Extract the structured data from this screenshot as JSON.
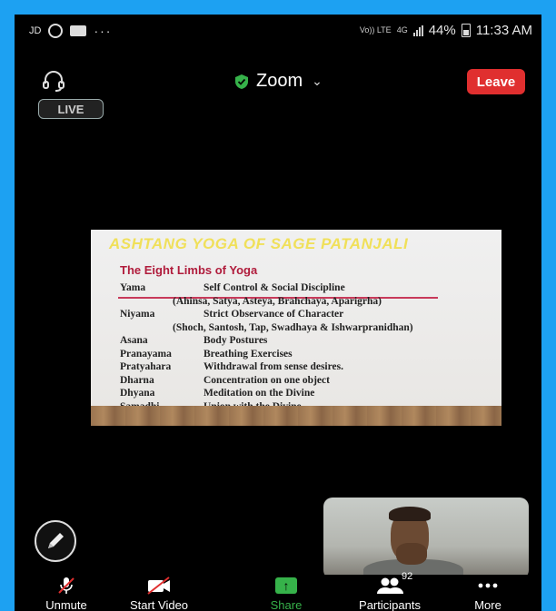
{
  "status_bar": {
    "left_label": "JD",
    "overflow": "···",
    "volte": "Vo)) LTE",
    "network": "4G",
    "battery": "44%",
    "time": "11:33 AM"
  },
  "meeting": {
    "title": "Zoom",
    "chevron": "⌄",
    "leave_label": "Leave",
    "live_label": "LIVE"
  },
  "slide": {
    "title": "ASHTANG YOGA OF SAGE PATANJALI",
    "subtitle": "The Eight Limbs of Yoga",
    "rows": [
      {
        "term": "Yama",
        "desc": "Self Control & Social Discipline"
      },
      {
        "term": "",
        "desc": "(Ahinsa, Satya, Asteya, Brahchaya, Aparigrha)"
      },
      {
        "term": "Niyama",
        "desc": "Strict Observance of Character"
      },
      {
        "term": "",
        "desc": "(Shoch, Santosh, Tap, Swadhaya & Ishwarpranidhan)"
      },
      {
        "term": "Asana",
        "desc": "Body Postures"
      },
      {
        "term": "Pranayama",
        "desc": "Breathing Exercises"
      },
      {
        "term": "Pratyahara",
        "desc": "Withdrawal from sense desires."
      },
      {
        "term": "Dharna",
        "desc": "Concentration on one object"
      },
      {
        "term": "Dhyana",
        "desc": "Meditation on the Divine"
      },
      {
        "term": "Samadhi",
        "desc": "Union with the Divine"
      }
    ]
  },
  "toolbar": {
    "unmute": "Unmute",
    "start_video": "Start Video",
    "share": "Share",
    "participants": "Participants",
    "participants_count": "92",
    "more": "More"
  },
  "colors": {
    "leave": "#e02f2f",
    "share": "#36b24a",
    "shield": "#36b24a",
    "frame": "#1da1f2"
  }
}
